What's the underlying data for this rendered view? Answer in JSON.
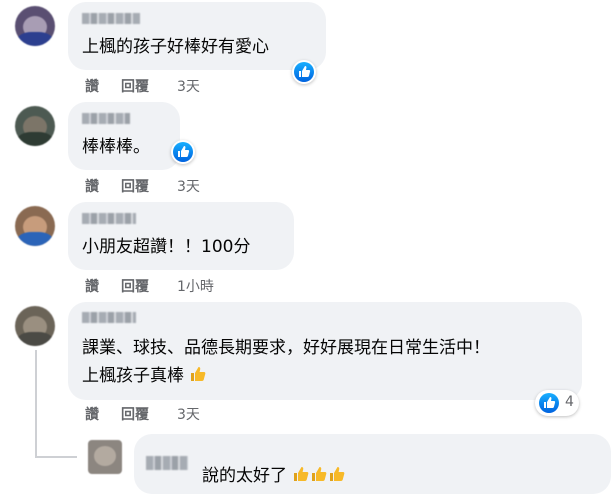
{
  "comments": [
    {
      "text": "上楓的孩子好棒好有愛心",
      "actions": {
        "like": "讚",
        "reply": "回覆",
        "time": "3天"
      }
    },
    {
      "text": "棒棒棒。",
      "actions": {
        "like": "讚",
        "reply": "回覆",
        "time": "3天"
      }
    },
    {
      "text": "小朋友超讚！！100分",
      "actions": {
        "like": "讚",
        "reply": "回覆",
        "time": "1小時"
      }
    },
    {
      "text_line1": "課業、球技、品德長期要求，好好展現在日常生活中！",
      "text_line2": "上楓孩子真棒",
      "actions": {
        "like": "讚",
        "reply": "回覆",
        "time": "3天"
      },
      "reaction_count": "4"
    }
  ],
  "reply": {
    "text": "說的太好了"
  },
  "icons": {
    "reaction": "like-thumb-icon",
    "emoji": "thumbs-up-emoji-icon"
  },
  "colors": {
    "bubble": "#f0f2f5",
    "action_text": "#65676b",
    "like_blue": "#1877f2",
    "thumbs_yellow": "#f7b928"
  }
}
